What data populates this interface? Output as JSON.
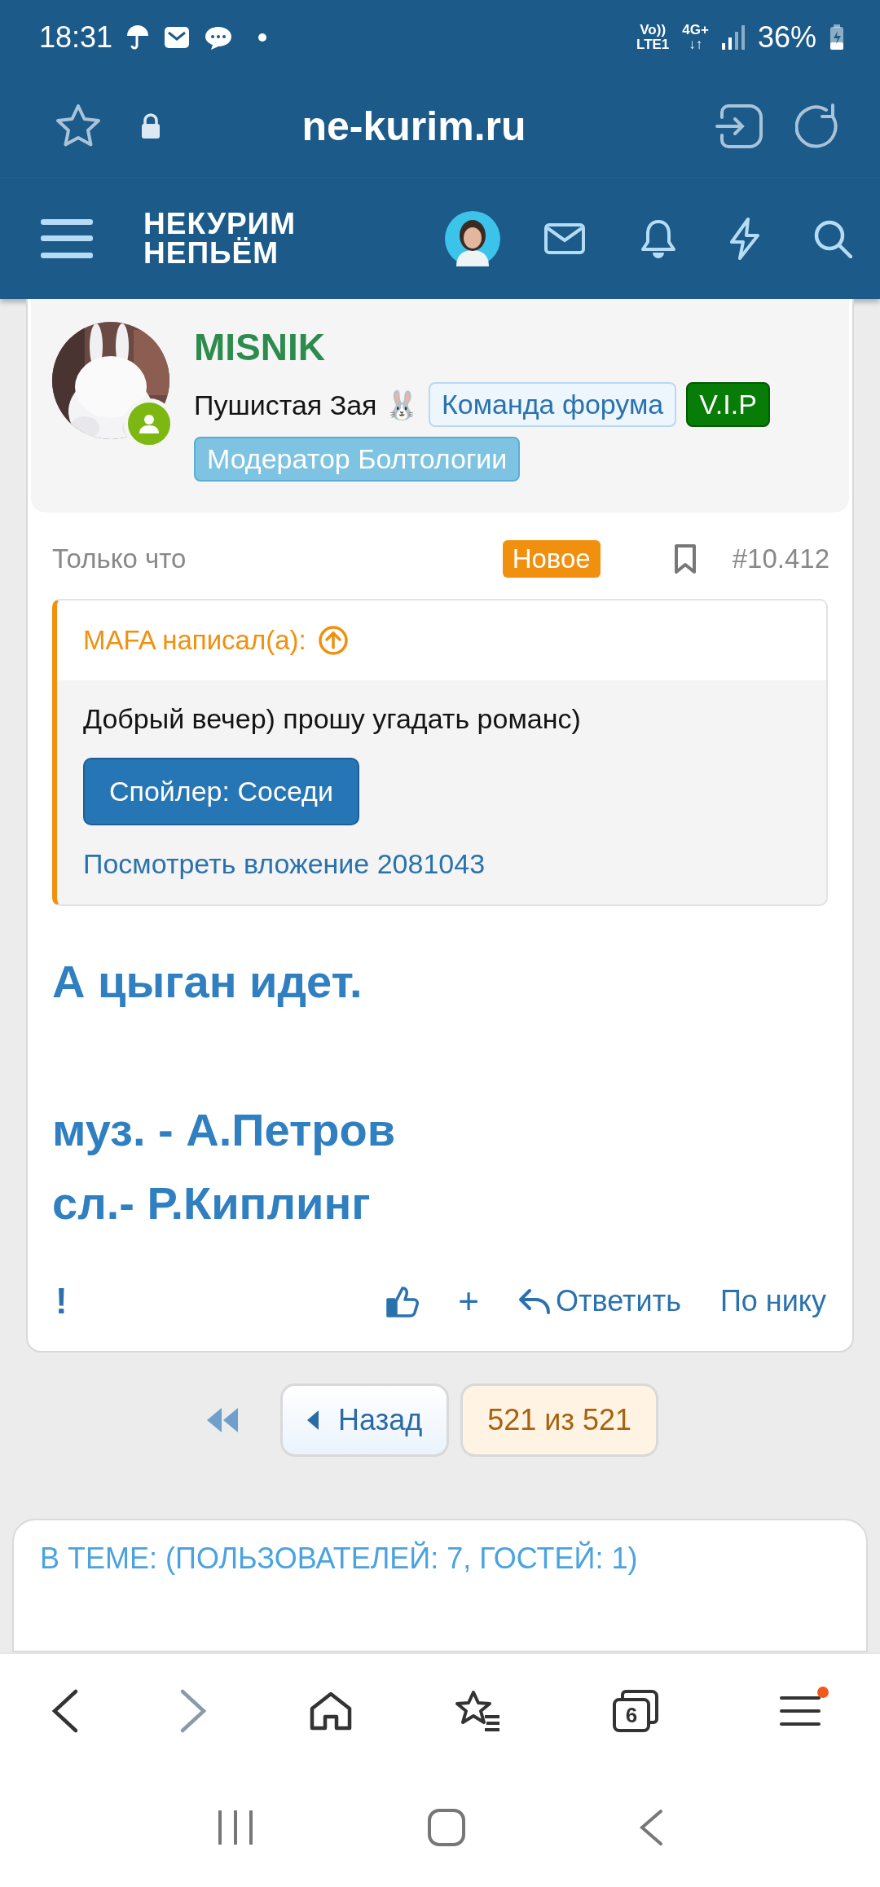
{
  "status_bar": {
    "time": "18:31",
    "network_top": "Vo))",
    "network_bottom": "LTE1",
    "data_top": "4G+",
    "data_bottom": "↓↑",
    "battery": "36%"
  },
  "address_bar": {
    "url": "ne-kurim.ru"
  },
  "site_header": {
    "logo_line_1": "НЕКУРИМ",
    "logo_line_2": "НЕПЬЁМ"
  },
  "post": {
    "author": "MISNIK",
    "title": "Пушистая Зая 🐰",
    "online": true,
    "badges": [
      {
        "label": "Команда форума",
        "kind": "team"
      },
      {
        "label": "V.I.P",
        "kind": "vip"
      },
      {
        "label": "Модератор Болтологии",
        "kind": "moderator"
      }
    ],
    "time": "Только что",
    "new_label": "Новое",
    "number": "#10.412",
    "quote": {
      "author": "MAFA написал(а):",
      "text": "Добрый вечер) прошу угадать романс)",
      "spoiler": "Спойлер: Соседи",
      "attachment": "Посмотреть вложение 2081043"
    },
    "body": [
      [
        "А цыган идет."
      ],
      [
        "муз. - А.Петров",
        "сл.- Р.Киплинг"
      ]
    ],
    "actions": {
      "report": "!",
      "add": "+",
      "reply": "Ответить",
      "by_nick": "По нику"
    }
  },
  "pagination": {
    "back": "Назад",
    "page": "521 из 521"
  },
  "in_topic": {
    "title": "В ТЕМЕ: (ПОЛЬЗОВАТЕЛЕЙ: 7, ГОСТЕЙ: 1)"
  },
  "bottom_nav": {
    "tabs_count": "6",
    "has_update": true
  }
}
